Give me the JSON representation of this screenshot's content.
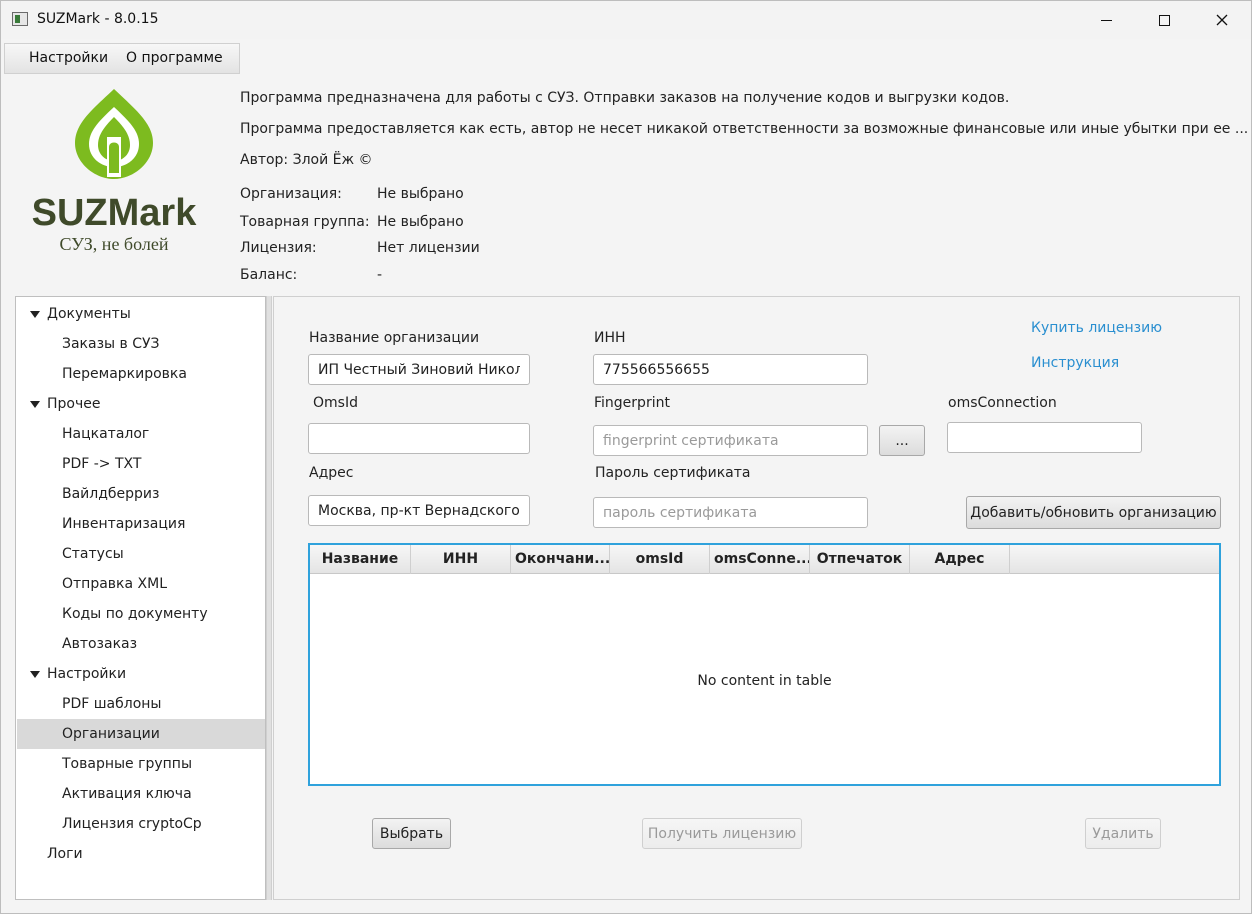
{
  "window": {
    "title": "SUZMark - 8.0.15"
  },
  "menu": {
    "settings": "Настройки",
    "about": "О программе"
  },
  "logo": {
    "text": "SUZMark",
    "slogan": "СУЗ, не болей"
  },
  "header": {
    "desc1": "Программа предназначена для работы с СУЗ. Отправки заказов на получение кодов и выгрузки кодов.",
    "desc2": "Программа предоставляется как есть, автор не несет никакой ответственности за возможные финансовые или иные убытки при ее ...",
    "author": "Автор: Злой Ёж ©",
    "info": [
      {
        "label": "Организация:",
        "value": "Не выбрано"
      },
      {
        "label": "Товарная группа:",
        "value": "Не выбрано"
      },
      {
        "label": "Лицензия:",
        "value": "Нет лицензии"
      },
      {
        "label": "Баланс:",
        "value": "-"
      }
    ]
  },
  "nav": {
    "items": [
      {
        "label": "Документы",
        "type": "group"
      },
      {
        "label": "Заказы в СУЗ",
        "type": "child"
      },
      {
        "label": "Перемаркировка",
        "type": "child"
      },
      {
        "label": "Прочее",
        "type": "group"
      },
      {
        "label": "Нацкаталог",
        "type": "child"
      },
      {
        "label": "PDF -> TXT",
        "type": "child"
      },
      {
        "label": "Вайлдберриз",
        "type": "child"
      },
      {
        "label": "Инвентаризация",
        "type": "child"
      },
      {
        "label": "Статусы",
        "type": "child"
      },
      {
        "label": "Отправка XML",
        "type": "child"
      },
      {
        "label": "Коды по документу",
        "type": "child"
      },
      {
        "label": "Автозаказ",
        "type": "child"
      },
      {
        "label": "Настройки",
        "type": "group"
      },
      {
        "label": "PDF шаблоны",
        "type": "child"
      },
      {
        "label": "Организации",
        "type": "child",
        "selected": true
      },
      {
        "label": "Товарные группы",
        "type": "child"
      },
      {
        "label": "Активация ключа",
        "type": "child"
      },
      {
        "label": "Лицензия cryptoCp",
        "type": "child"
      },
      {
        "label": "Логи",
        "type": "leaf"
      }
    ]
  },
  "form": {
    "org_name_label": "Название организации",
    "org_name_value": "ИП Честный Зиновий Николаевич",
    "inn_label": "ИНН",
    "inn_value": "775566556655",
    "omsid_label": "OmsId",
    "omsid_value": "",
    "fingerprint_label": "Fingerprint",
    "fingerprint_placeholder": "fingerprint сертификата",
    "browse_label": "...",
    "oms_connection_label": "omsConnection",
    "oms_connection_value": "",
    "address_label": "Адрес",
    "address_value": "Москва, пр-кт Вернадского, д",
    "cert_password_label": "Пароль сертификата",
    "cert_password_placeholder": "пароль сертификата",
    "add_update_button": "Добавить/обновить организацию"
  },
  "links": {
    "buy_license": "Купить лицензию",
    "instruction": "Инструкция"
  },
  "table": {
    "columns": [
      "Название",
      "ИНН",
      "Окончани...",
      "omsId",
      "omsConne...",
      "Отпечаток",
      "Адрес"
    ],
    "rows": [],
    "empty_message": "No content in table"
  },
  "actions": {
    "select": "Выбрать",
    "get_license": "Получить лицензию",
    "delete": "Удалить"
  },
  "colors": {
    "accent": "#2fa2dc",
    "link": "#2a8fd0",
    "logo_green": "#7dbb1f",
    "logo_dark": "#3f4a2a"
  }
}
